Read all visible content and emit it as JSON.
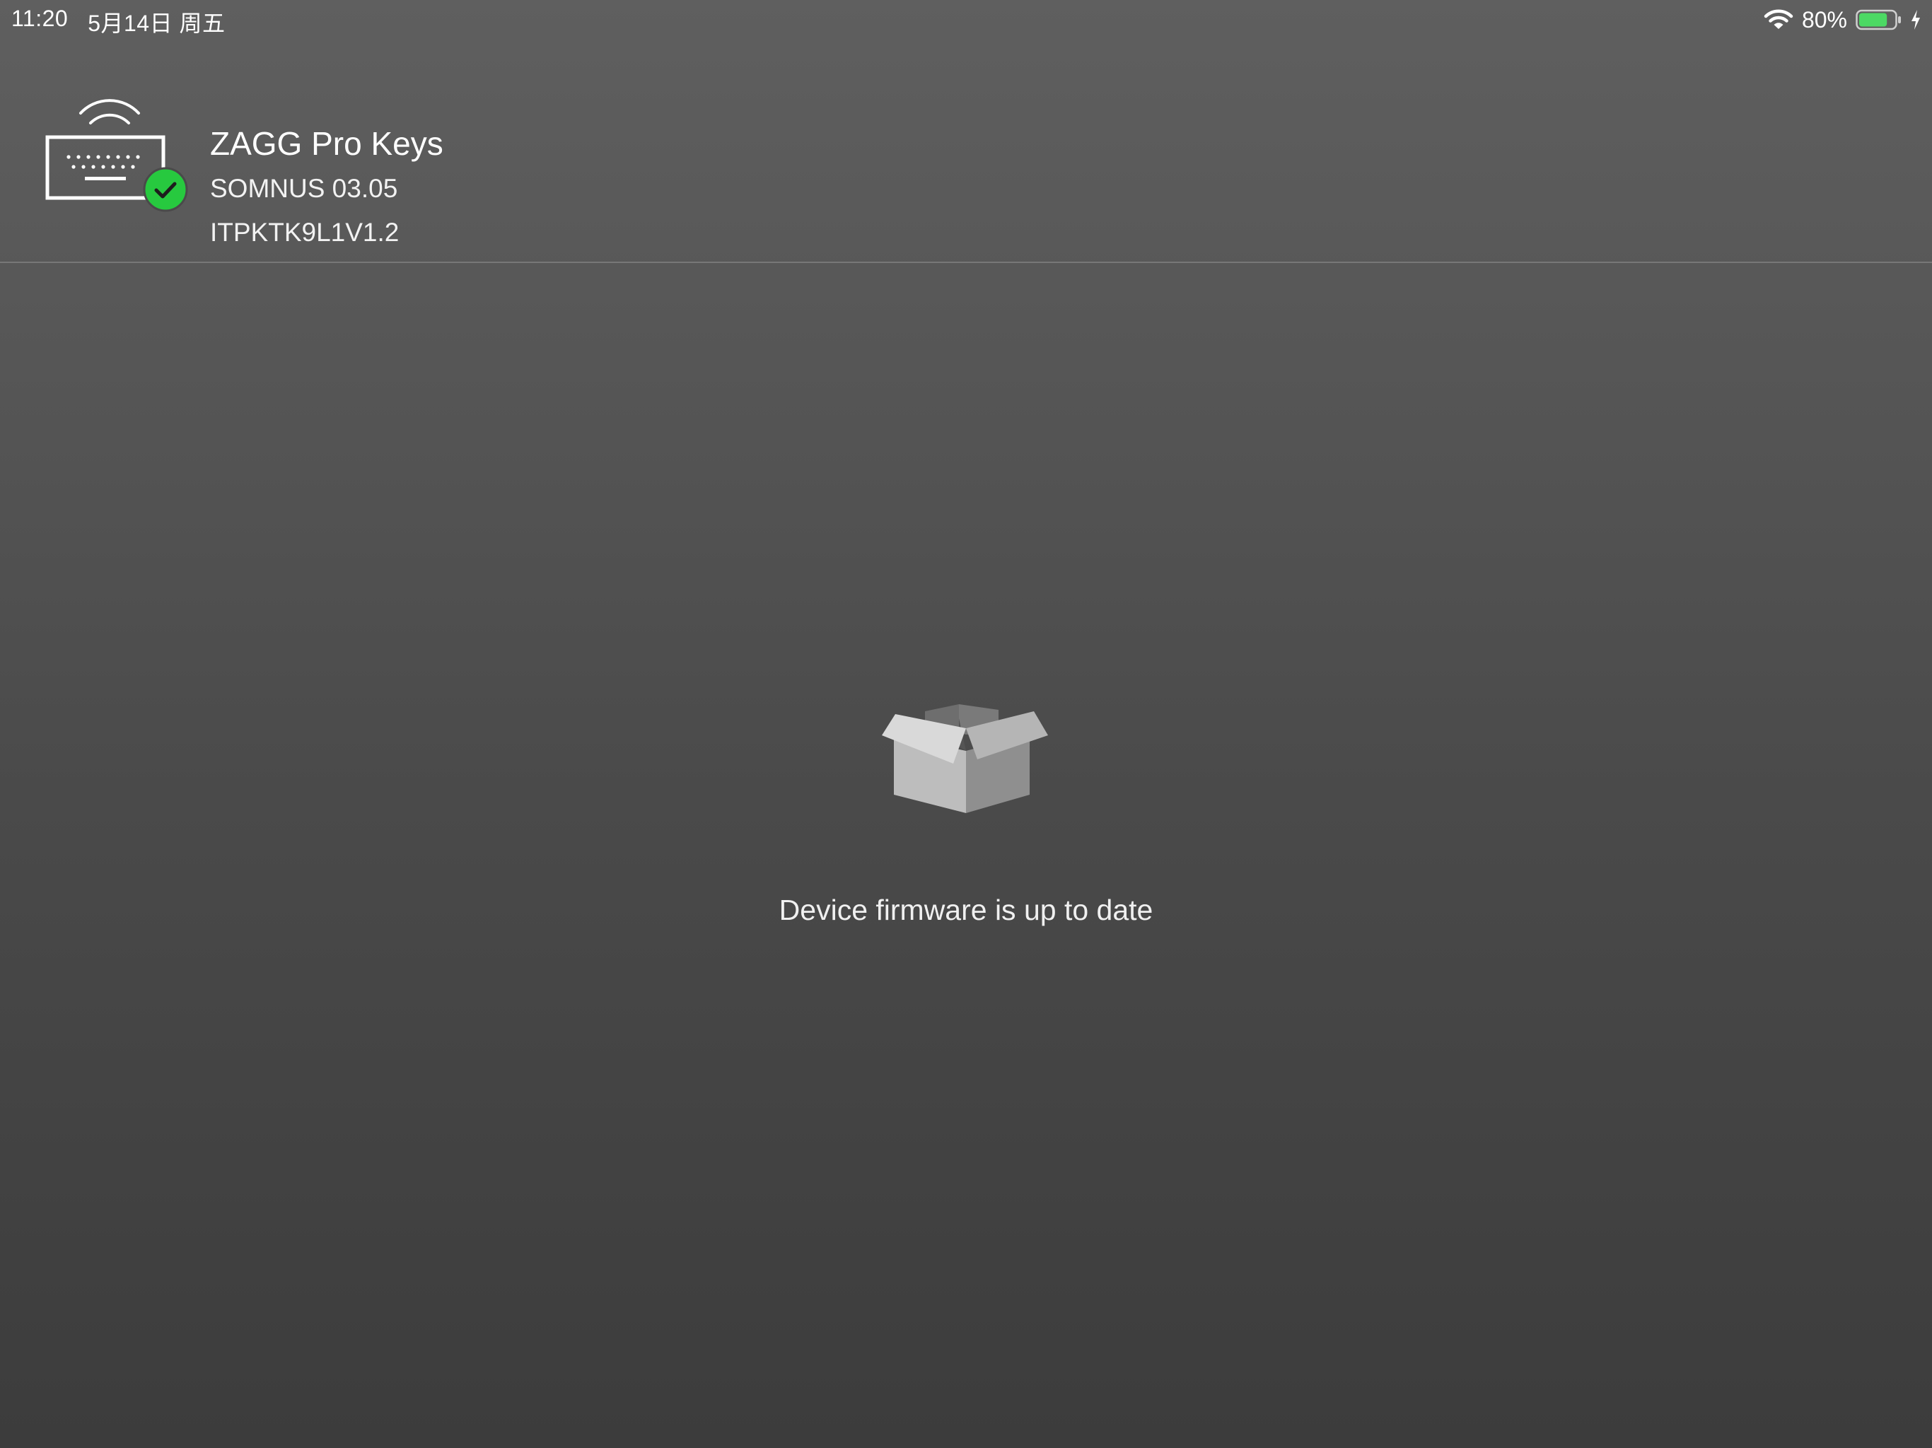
{
  "status_bar": {
    "time": "11:20",
    "date": "5月14日 周五",
    "battery_percent": "80%",
    "battery_level": 0.8,
    "battery_color": "#4cd964",
    "icons": [
      "wifi-icon",
      "battery-icon",
      "charging-icon"
    ]
  },
  "device": {
    "name": "ZAGG Pro Keys",
    "firmware": "SOMNUS 03.05",
    "model": "ITPKTK9L1V1.2",
    "icon": "keyboard-wireless-icon",
    "connected_badge_icon": "check-badge-icon",
    "badge_color": "#27c93f"
  },
  "main": {
    "icon": "open-box-icon",
    "message": "Device firmware is up to date"
  }
}
